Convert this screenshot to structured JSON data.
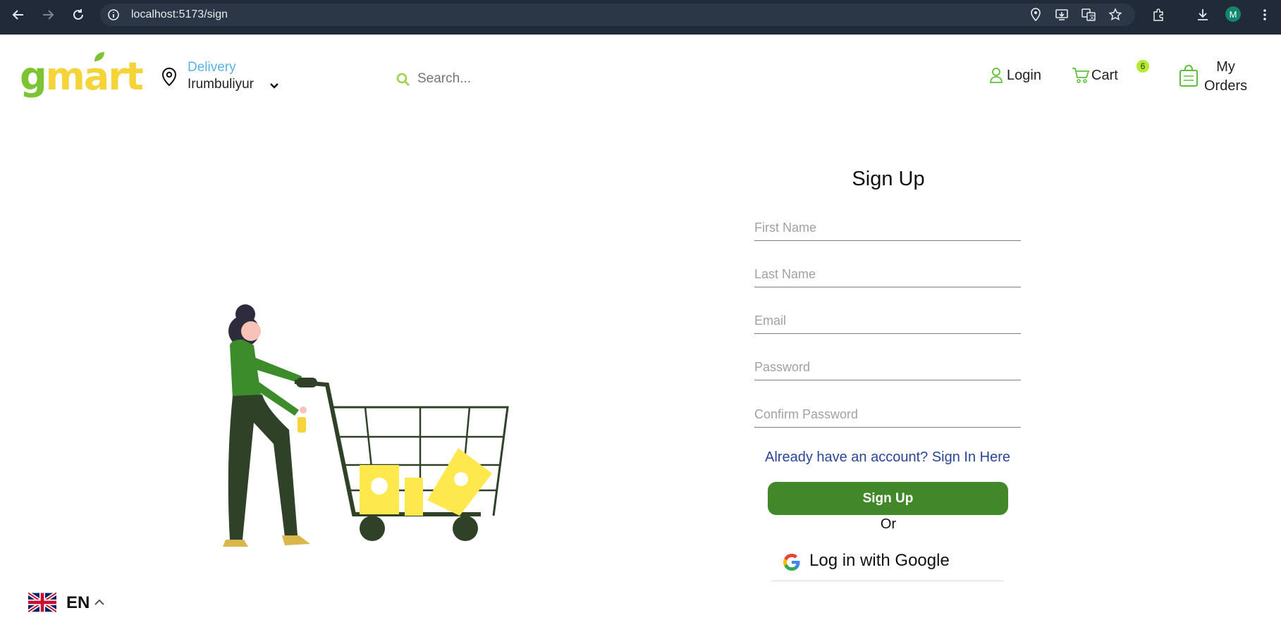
{
  "browser": {
    "url": "localhost:5173/sign",
    "profile_initial": "M"
  },
  "header": {
    "logo": {
      "first": "g",
      "rest": "mart"
    },
    "delivery_label": "Delivery",
    "delivery_city": "Irumbuliyur",
    "search_placeholder": "Search...",
    "login_label": "Login",
    "cart_label": "Cart",
    "cart_count": "6",
    "orders_line1": "My",
    "orders_line2": "Orders"
  },
  "form": {
    "title": "Sign Up",
    "fields": [
      {
        "placeholder": "First Name",
        "value": ""
      },
      {
        "placeholder": "Last Name",
        "value": ""
      },
      {
        "placeholder": "Email",
        "value": ""
      },
      {
        "placeholder": "Password",
        "value": ""
      },
      {
        "placeholder": "Confirm Password",
        "value": ""
      }
    ],
    "signin_link": "Already have an account? Sign In Here",
    "submit_label": "Sign Up",
    "or_label": "Or",
    "google_label": "Log in with Google"
  },
  "language": {
    "code": "EN"
  },
  "colors": {
    "brand_green": "#42882a",
    "logo_green": "#7cc433",
    "logo_yellow": "#f5d43a",
    "link_blue": "#2a4597",
    "delivery_blue": "#59b3e6",
    "badge": "#b3ec2f"
  }
}
